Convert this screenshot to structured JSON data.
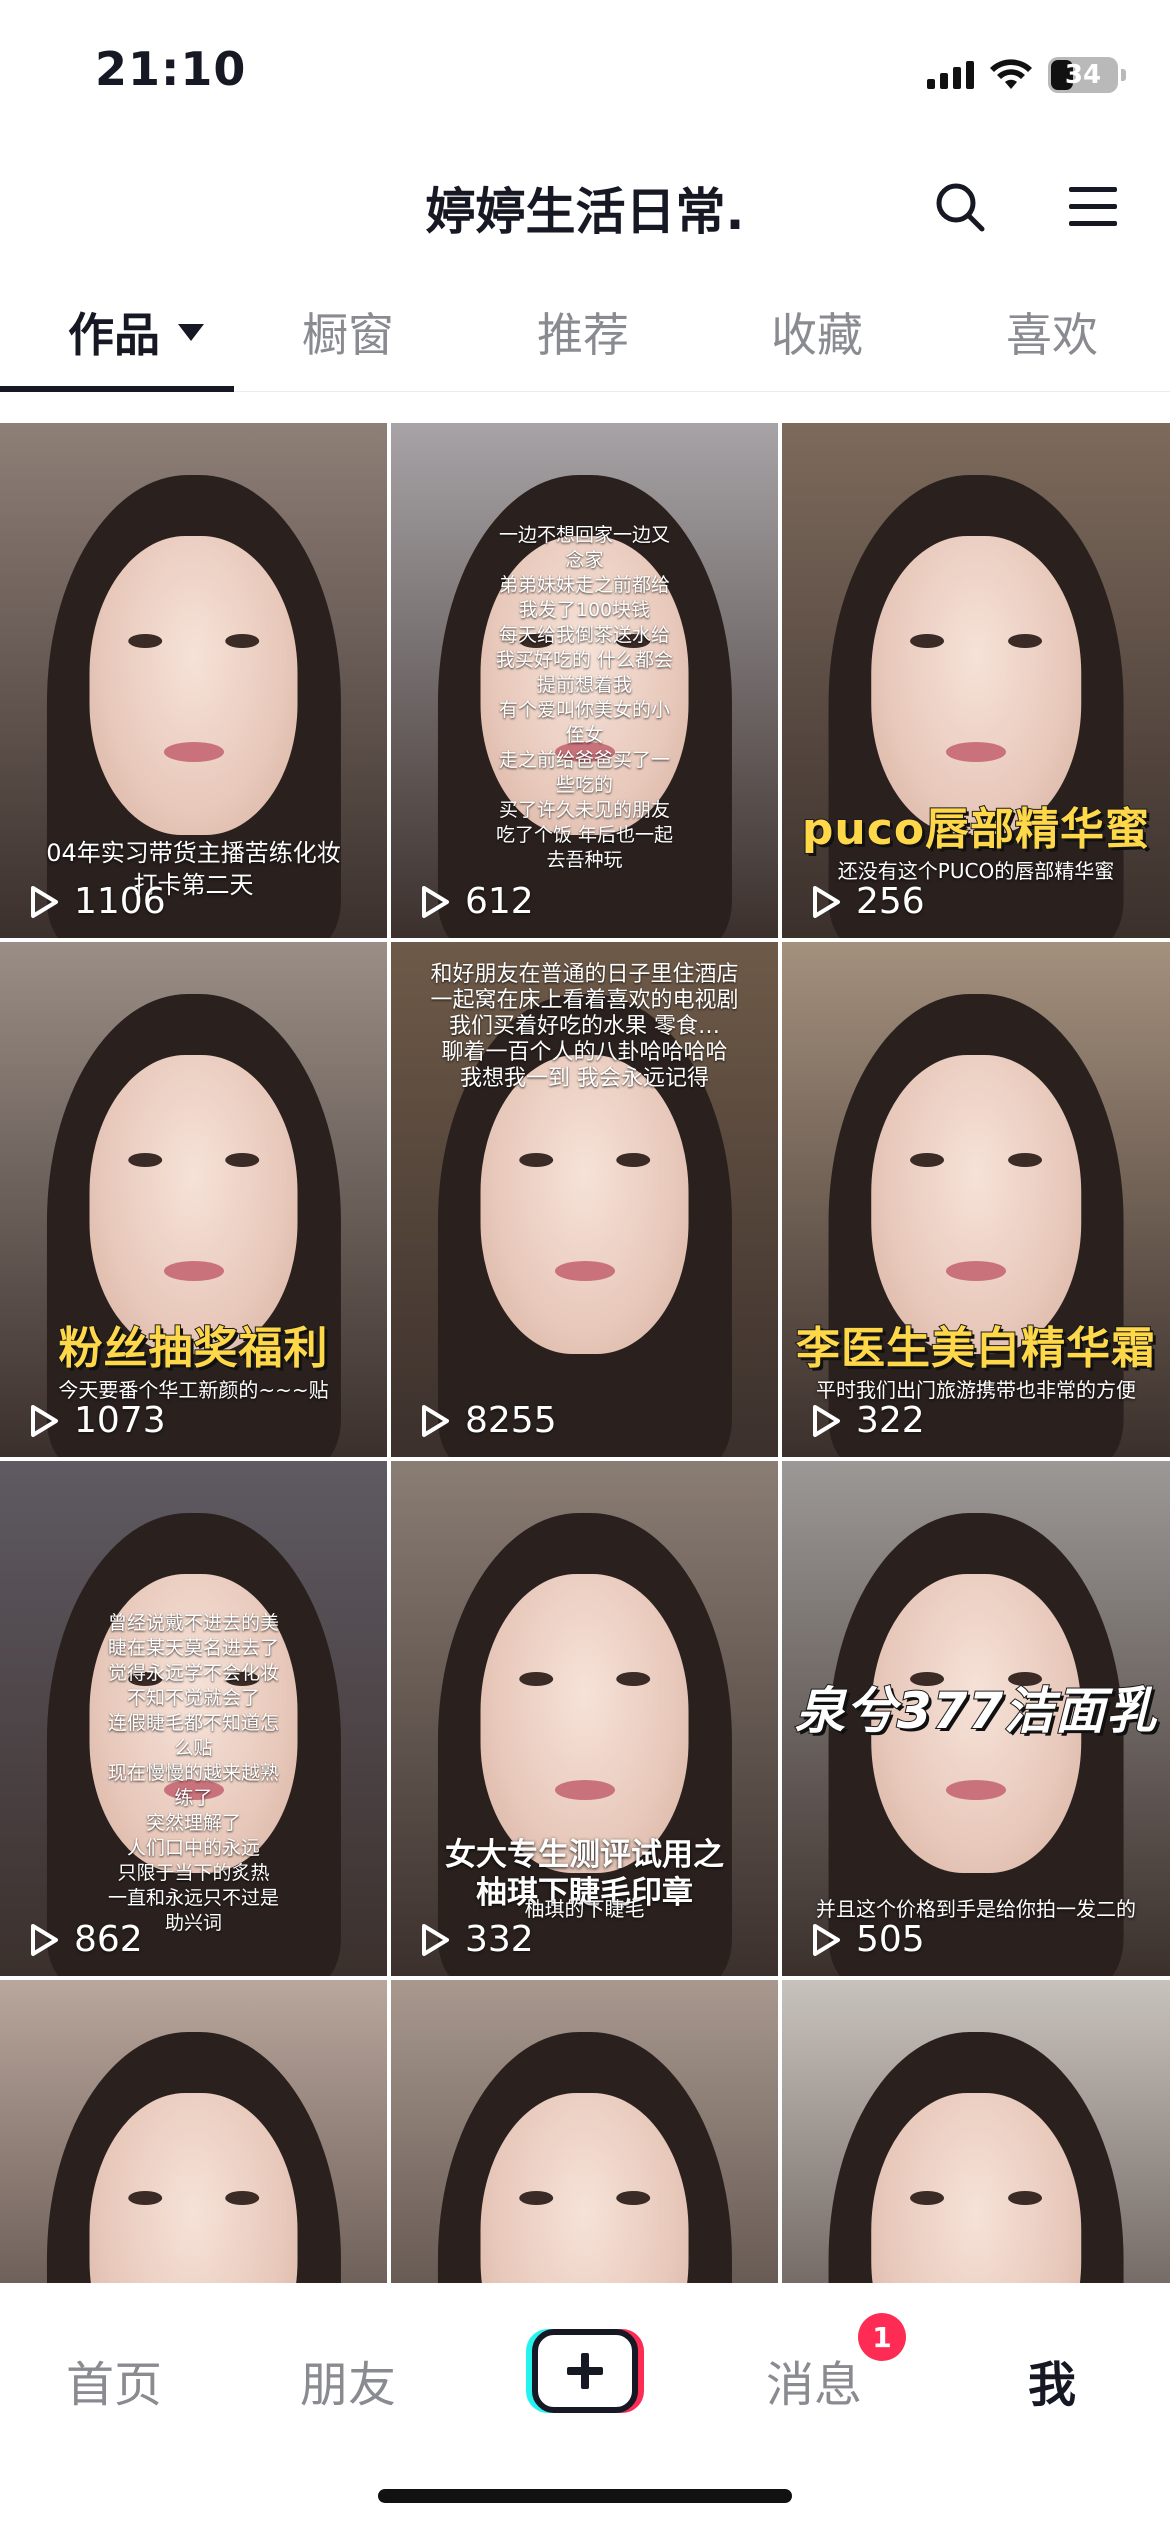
{
  "status_bar": {
    "time": "21:10",
    "battery": "34",
    "battery_level": 0.34
  },
  "header": {
    "title": "婷婷生活日常.",
    "icons": [
      "search-icon",
      "menu-icon"
    ]
  },
  "tabs": [
    {
      "label": "作品",
      "active": true
    },
    {
      "label": "橱窗",
      "active": false
    },
    {
      "label": "推荐",
      "active": false
    },
    {
      "label": "收藏",
      "active": false
    },
    {
      "label": "喜欢",
      "active": false
    }
  ],
  "videos": [
    {
      "plays": "1106",
      "caption_small": "04年实习带货主播苦练化妆",
      "caption_small2": "打卡第二天",
      "bg": "#8e7f77"
    },
    {
      "plays": "612",
      "bg": "#a7a3a6",
      "overlay": [
        "一边不想回家一边又",
        "念家",
        "弟弟妹妹走之前都给",
        "我发了100块钱",
        "每天给我倒茶送水给",
        "我买好吃的 什么都会",
        "提前想着我",
        "有个爱叫你美女的小",
        "侄女",
        "走之前给爸爸买了一",
        "些吃的",
        "买了许久未见的朋友",
        "吃了个饭 年后也一起",
        "去吾种玩"
      ]
    },
    {
      "plays": "256",
      "caption_big": "puco唇部精华蜜",
      "caption_small": "还没有这个PUCO的唇部精华蜜",
      "bg": "#7d6a5c"
    },
    {
      "plays": "1073",
      "caption_big": "粉丝抽奖福利",
      "caption_small": "今天要番个华工新颜的~~~贴",
      "bg": "#9a8e86"
    },
    {
      "plays": "8255",
      "overlay": [
        "和好朋友在普通的日子里住酒店",
        "一起窝在床上看着喜欢的电视剧",
        "我们买着好吃的水果 零食…",
        "聊着一百个人的八卦哈哈哈哈",
        "我想我一到 我会永远记得"
      ],
      "bg": "#6e5a48"
    },
    {
      "plays": "322",
      "caption_big": "李医生美白精华霜",
      "caption_small": "平时我们出门旅游携带也非常的方便",
      "bg": "#a4907d"
    },
    {
      "plays": "862",
      "bg": "#5f5a63",
      "overlay": [
        "曾经说戴不进去的美",
        "睫在某天莫名进去了",
        "觉得永远学不会化妆",
        "不知不觉就会了",
        "连假睫毛都不知道怎",
        "么贴",
        "现在慢慢的越来越熟",
        "练了",
        "突然理解了",
        "人们口中的永远",
        "只限于当下的炙热",
        "一直和永远只不过是",
        "助兴词"
      ]
    },
    {
      "plays": "332",
      "caption_medium": [
        "女大专生测评试用之",
        "柚琪下睫毛印章"
      ],
      "caption_small": "柚琪的下睫毛",
      "bg": "#8a7d74"
    },
    {
      "plays": "505",
      "caption_big": "泉兮377洁面乳",
      "caption_small": "并且这个价格到手是给你拍一发二的",
      "bg": "#9c9896"
    },
    {
      "plays": "",
      "bg": "#b9a69c"
    },
    {
      "plays": "",
      "bg": "#a8988e"
    },
    {
      "plays": "",
      "bg": "#c8c2bd"
    }
  ],
  "bottom_nav": {
    "items": [
      {
        "label": "首页",
        "active": false
      },
      {
        "label": "朋友",
        "active": false
      },
      {
        "label": "消息",
        "active": false,
        "badge": "1"
      },
      {
        "label": "我",
        "active": true
      }
    ]
  },
  "colors": {
    "accent": "#fe2c55",
    "text": "#161823",
    "muted": "#8a8b91"
  }
}
